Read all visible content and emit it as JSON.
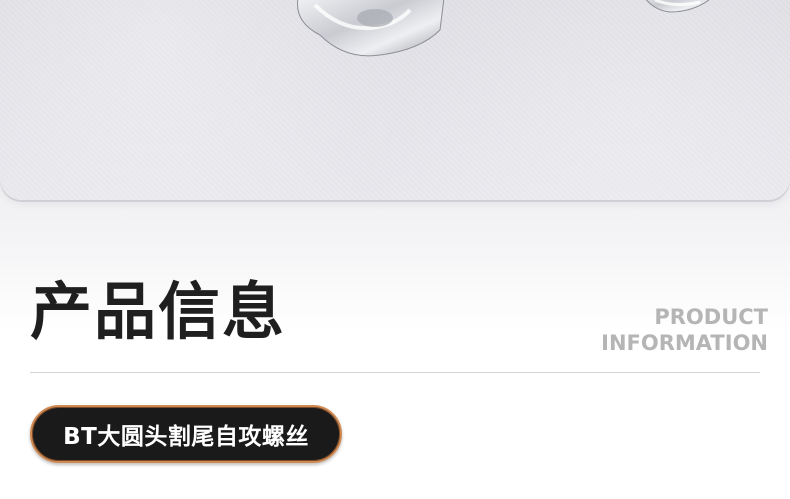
{
  "section": {
    "title_zh": "产品信息",
    "title_en_line1": "PRODUCT",
    "title_en_line2": "INFORMATION"
  },
  "product": {
    "name": "BT大圆头割尾自攻螺丝"
  },
  "colors": {
    "title": "#1f1f1f",
    "subtitle": "#b5b5b5",
    "badge_bg": "#1a1a1a",
    "badge_border": "#d08a52",
    "divider": "#d4d4d4"
  },
  "icons": {
    "product_photo": "screw-photo"
  }
}
